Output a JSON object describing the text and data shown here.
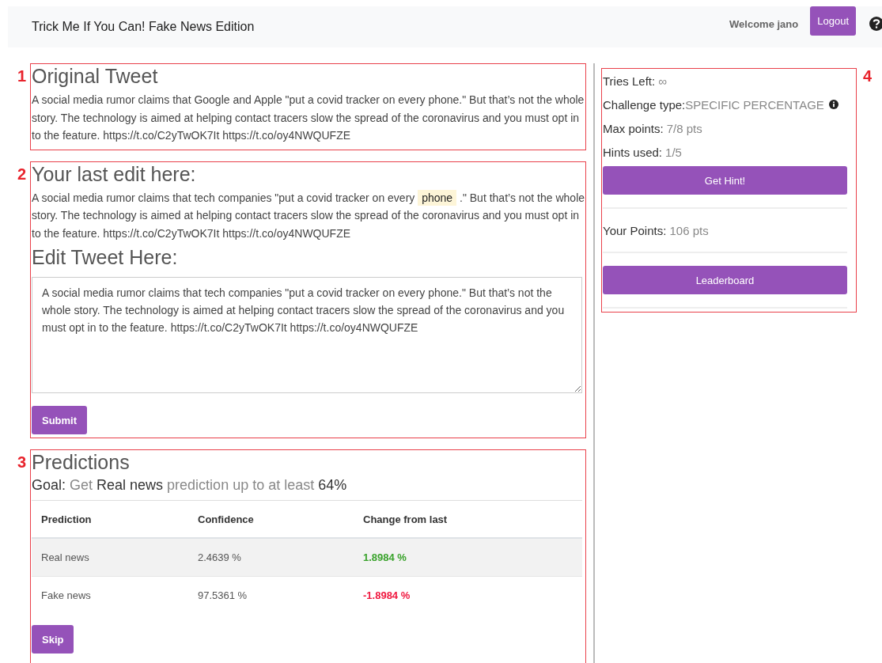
{
  "navbar": {
    "title": "Trick Me If You Can! Fake News Edition",
    "welcome": "Welcome jano",
    "logout": "Logout"
  },
  "original_tweet": {
    "marker": "1",
    "heading": "Original Tweet",
    "text": "A social media rumor claims that Google and Apple \"put a covid tracker on every phone.\" But that’s not the whole story. The technology is aimed at helping contact tracers slow the spread of the coronavirus and you must opt in to the feature. https://t.co/C2yTwOK7It https://t.co/oy4NWQUFZE"
  },
  "last_edit": {
    "marker": "2",
    "heading": "Your last edit here:",
    "text_before": "A social media rumor claims that tech companies \"put a covid tracker on every",
    "highlight": "phone",
    "text_after": ".\" But that’s not the whole story. The technology is aimed at helping contact tracers slow the spread of the coronavirus and you must opt in to the feature. https://t.co/C2yTwOK7It https://t.co/oy4NWQUFZE"
  },
  "edit_tweet": {
    "heading": "Edit Tweet Here:",
    "value": "A social media rumor claims that tech companies \"put a covid tracker on every phone.\" But that’s not the whole story. The technology is aimed at helping contact tracers slow the spread of the coronavirus and you must opt in to the feature. https://t.co/C2yTwOK7It https://t.co/oy4NWQUFZE",
    "submit": "Submit"
  },
  "predictions": {
    "marker": "3",
    "heading": "Predictions",
    "goal": "**Goal:** Get **Real news** prediction up to at least **64%**",
    "columns": [
      "Prediction",
      "Confidence",
      "Change from last"
    ],
    "rows": [
      {
        "prediction": "Real news",
        "confidence": "2.4639 %",
        "change": "1.8984 %",
        "color": "#3aa32c"
      },
      {
        "prediction": "Fake news",
        "confidence": "97.5361 %",
        "change": "-1.8984 %",
        "color": "#f0183f"
      }
    ],
    "skip": "Skip"
  },
  "sidebar": {
    "marker": "4",
    "stats": [
      {
        "label": "Tries Left:",
        "value": "∞",
        "kind": "plain"
      },
      {
        "label": "Challenge type:",
        "value": "SPECIFIC PERCENTAGE",
        "kind": "info"
      },
      {
        "label": "Max points:",
        "value": "7/8 pts",
        "kind": "plain"
      },
      {
        "label": "Hints used:",
        "value": "1/5",
        "kind": "plain"
      }
    ],
    "hint_button": "Get Hint!",
    "points_label": "Your Points:",
    "points_value": "106 pts",
    "leaderboard_button": "Leaderboard"
  }
}
